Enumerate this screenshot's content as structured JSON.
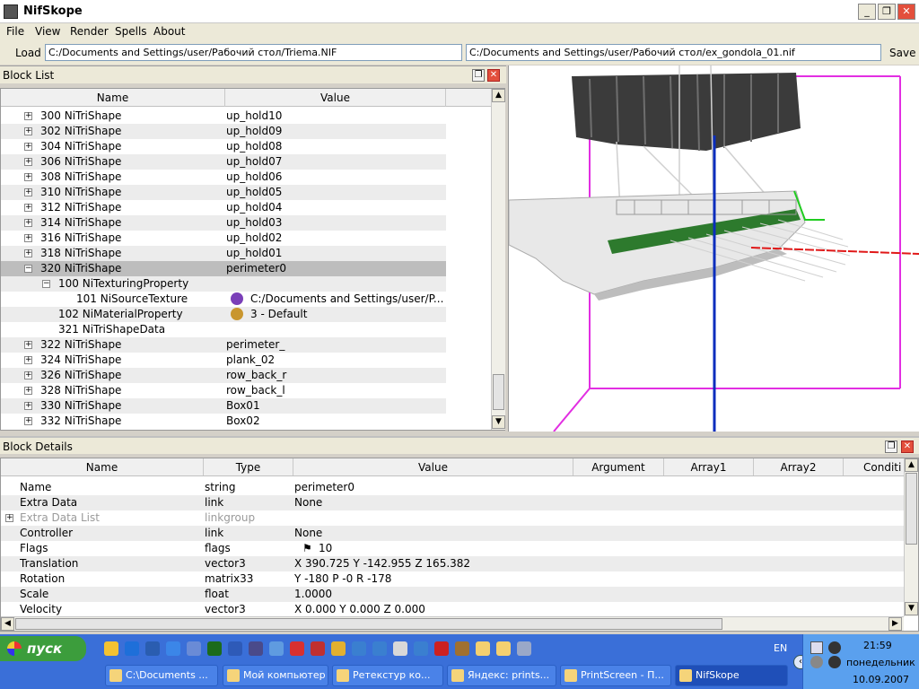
{
  "window": {
    "title": "NifSkope"
  },
  "menu": [
    "File",
    "View",
    "Render",
    "Spells",
    "About"
  ],
  "loadbar": {
    "load_label": "Load",
    "load_path": "C:/Documents and Settings/user/Рабочий стол/Triema.NIF",
    "save_path": "C:/Documents and Settings/user/Рабочий стол/ex_gondola_01.nif",
    "save_label": "Save"
  },
  "block_list": {
    "title": "Block List",
    "columns": [
      "Name",
      "Value"
    ],
    "rows": [
      {
        "name": "300 NiTriShape",
        "value": "up_hold10",
        "expander": "+"
      },
      {
        "name": "302 NiTriShape",
        "value": "up_hold09",
        "expander": "+"
      },
      {
        "name": "304 NiTriShape",
        "value": "up_hold08",
        "expander": "+"
      },
      {
        "name": "306 NiTriShape",
        "value": "up_hold07",
        "expander": "+"
      },
      {
        "name": "308 NiTriShape",
        "value": "up_hold06",
        "expander": "+"
      },
      {
        "name": "310 NiTriShape",
        "value": "up_hold05",
        "expander": "+"
      },
      {
        "name": "312 NiTriShape",
        "value": "up_hold04",
        "expander": "+"
      },
      {
        "name": "314 NiTriShape",
        "value": "up_hold03",
        "expander": "+"
      },
      {
        "name": "316 NiTriShape",
        "value": "up_hold02",
        "expander": "+"
      },
      {
        "name": "318 NiTriShape",
        "value": "up_hold01",
        "expander": "+"
      },
      {
        "name": "320 NiTriShape",
        "value": "perimeter0",
        "expander": "−",
        "selected": true
      },
      {
        "name": "100 NiTexturingProperty",
        "value": "",
        "expander": "−",
        "indent": 1
      },
      {
        "name": "101 NiSourceTexture",
        "value": "C:/Documents and Settings/user/P...",
        "expander": "",
        "indent": 2,
        "icon": "texture-icon"
      },
      {
        "name": "102 NiMaterialProperty",
        "value": "3 - Default",
        "expander": "",
        "indent": 1,
        "icon": "palette-icon"
      },
      {
        "name": "321 NiTriShapeData",
        "value": "",
        "expander": "",
        "indent": 1
      },
      {
        "name": "322 NiTriShape",
        "value": "perimeter_",
        "expander": "+"
      },
      {
        "name": "324 NiTriShape",
        "value": "plank_02",
        "expander": "+"
      },
      {
        "name": "326 NiTriShape",
        "value": "row_back_r",
        "expander": "+"
      },
      {
        "name": "328 NiTriShape",
        "value": "row_back_l",
        "expander": "+"
      },
      {
        "name": "330 NiTriShape",
        "value": "Box01",
        "expander": "+"
      },
      {
        "name": "332 NiTriShape",
        "value": "Box02",
        "expander": "+"
      }
    ]
  },
  "block_details": {
    "title": "Block Details",
    "columns": [
      "Name",
      "Type",
      "Value",
      "Argument",
      "Array1",
      "Array2",
      "Conditi"
    ],
    "rows": [
      {
        "name": "Name",
        "type": "string",
        "value": "perimeter0"
      },
      {
        "name": "Extra Data",
        "type": "link",
        "value": "None"
      },
      {
        "name": "Extra Data List",
        "type": "linkgroup",
        "value": "",
        "expander": "+",
        "dim": true
      },
      {
        "name": "Controller",
        "type": "link",
        "value": "None"
      },
      {
        "name": "Flags",
        "type": "flags",
        "value": "10",
        "icon": "flag-icon"
      },
      {
        "name": "Translation",
        "type": "vector3",
        "value": "X 390.725 Y -142.955 Z 165.382"
      },
      {
        "name": "Rotation",
        "type": "matrix33",
        "value": "Y -180 P -0 R -178"
      },
      {
        "name": "Scale",
        "type": "float",
        "value": "1.0000"
      },
      {
        "name": "Velocity",
        "type": "vector3",
        "value": "X 0.000 Y 0.000 Z 0.000"
      }
    ]
  },
  "taskbar": {
    "start_label": "пуск",
    "tasks": [
      {
        "label": "C:\\Documents ..."
      },
      {
        "label": "Мой компьютер"
      },
      {
        "label": "Ретекстур ко..."
      },
      {
        "label": "Яндекс: prints..."
      },
      {
        "label": "PrintScreen - П..."
      },
      {
        "label": "NifSkope",
        "active": true
      }
    ],
    "lang": "EN",
    "time": "21:59",
    "day": "понедельник",
    "date": "10.09.2007"
  }
}
